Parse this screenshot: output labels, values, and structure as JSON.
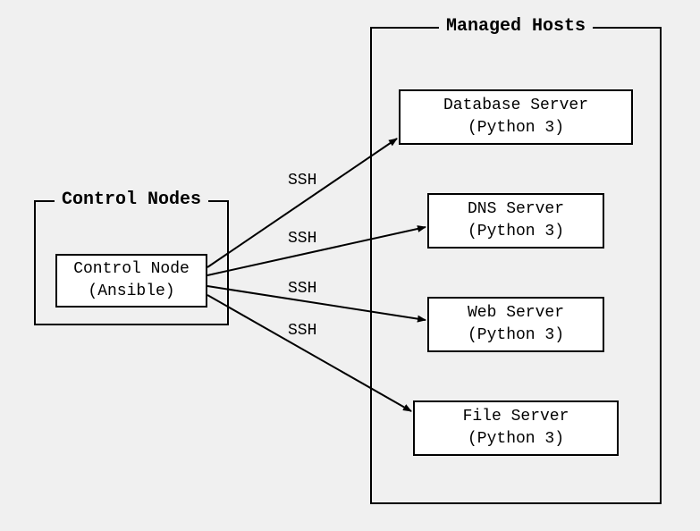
{
  "groups": {
    "control": {
      "title": "Control Nodes"
    },
    "managed": {
      "title": "Managed Hosts"
    }
  },
  "nodes": {
    "control_node": {
      "line1": "Control Node",
      "line2": "(Ansible)"
    },
    "db": {
      "line1": "Database Server",
      "line2": "(Python 3)"
    },
    "dns": {
      "line1": "DNS Server",
      "line2": "(Python 3)"
    },
    "web": {
      "line1": "Web Server",
      "line2": "(Python 3)"
    },
    "file": {
      "line1": "File Server",
      "line2": "(Python 3)"
    }
  },
  "edges": {
    "ssh1": "SSH",
    "ssh2": "SSH",
    "ssh3": "SSH",
    "ssh4": "SSH"
  }
}
